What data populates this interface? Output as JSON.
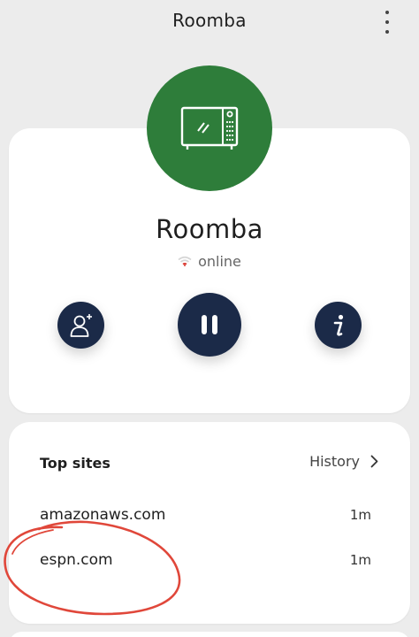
{
  "header": {
    "title": "Roomba",
    "menu_icon": "more-vertical-icon"
  },
  "device": {
    "name": "Roomba",
    "status": "online",
    "avatar_color": "#2e7d3a",
    "device_icon": "microwave-icon",
    "status_icon": "wifi-icon",
    "status_icon_color": "#d9342b"
  },
  "actions": {
    "button_color": "#1b2a48",
    "user": {
      "icon": "add-user-icon"
    },
    "pause": {
      "icon": "pause-icon"
    },
    "info": {
      "icon": "info-icon"
    }
  },
  "top_sites": {
    "title": "Top sites",
    "history_label": "History",
    "history_icon": "chevron-right-icon",
    "sites": [
      {
        "domain": "amazonaws.com",
        "time": "1m"
      },
      {
        "domain": "espn.com",
        "time": "1m"
      }
    ]
  },
  "annotation": {
    "color": "#e0473a",
    "shape": "hand-drawn circle around espn.com"
  }
}
